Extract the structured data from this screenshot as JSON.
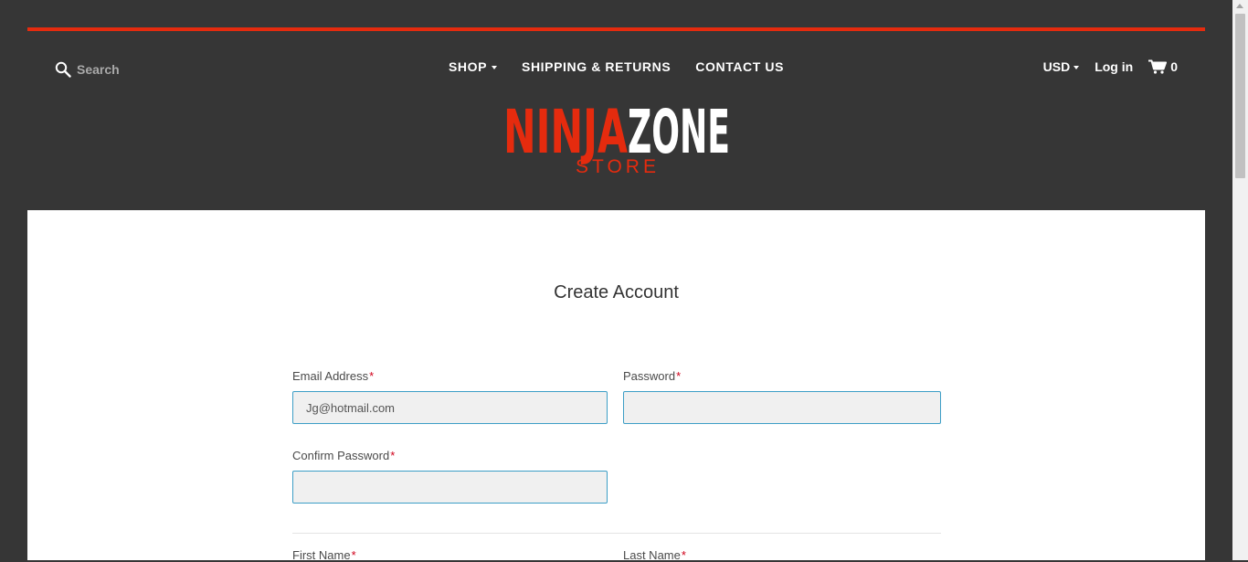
{
  "header": {
    "search_placeholder": "Search",
    "nav": [
      {
        "label": "SHOP",
        "has_dropdown": true
      },
      {
        "label": "SHIPPING & RETURNS",
        "has_dropdown": false
      },
      {
        "label": "CONTACT US",
        "has_dropdown": false
      }
    ],
    "currency": "USD",
    "login_label": "Log in",
    "cart_count": "0",
    "logo": {
      "word1": "NINJA",
      "word2": "ZONE",
      "sub": "STORE"
    }
  },
  "form": {
    "title": "Create Account",
    "required_marker": "*",
    "email": {
      "label": "Email Address",
      "value": "Jg@hotmail.com"
    },
    "password": {
      "label": "Password",
      "value": ""
    },
    "confirm_password": {
      "label": "Confirm Password",
      "value": ""
    },
    "first_name": {
      "label": "First Name"
    },
    "last_name": {
      "label": "Last Name"
    }
  },
  "colors": {
    "accent": "#e52b0e",
    "header_bg": "#363636",
    "input_border": "#3d9ec6",
    "required": "#d0021b"
  },
  "icons": [
    "search-icon",
    "cart-icon",
    "caret-down-icon"
  ]
}
